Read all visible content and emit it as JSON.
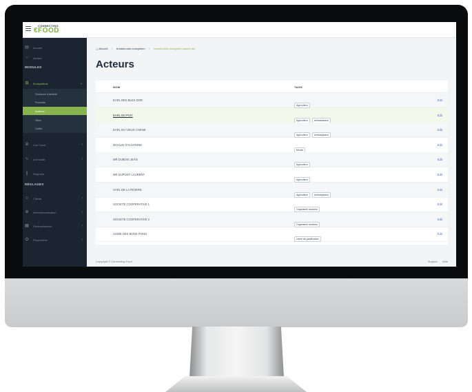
{
  "logo": {
    "top": "CONNECTING",
    "main": "€FOOD"
  },
  "sidebar": {
    "items": [
      {
        "icon": "▤",
        "label": "Accueil"
      },
      {
        "icon": "○",
        "label": "Alertes"
      }
    ],
    "section_modules": "MODULES",
    "ecosystem": {
      "icon": "⊟",
      "label": "Ecosystème",
      "chevron": "⌄"
    },
    "sub": [
      "Secteurs d'activité",
      "Produits",
      "Acteurs",
      "Sites",
      "Outils"
    ],
    "modules_after": [
      {
        "icon": "⦾",
        "label": "Live Track",
        "chevron": "›"
      },
      {
        "icon": "∿",
        "label": "Live Audit",
        "chevron": "›"
      },
      {
        "icon": "∥",
        "label": "Rapports",
        "chevron": ""
      }
    ],
    "section_reglages": "RÉGLAGES",
    "reglages": [
      {
        "icon": "☺",
        "label": "Clients",
        "chevron": "›"
      },
      {
        "icon": "⊕",
        "label": "Internationalisation",
        "chevron": "›"
      },
      {
        "icon": "▦",
        "label": "Géolocalisation",
        "chevron": "›"
      },
      {
        "icon": "⛭",
        "label": "Paramètres",
        "chevron": "›"
      }
    ]
  },
  "breadcrumb": {
    "home_icon": "⌂",
    "items": [
      "Accueil",
      "breadcrumb.ecosystem",
      "breadcrumb.ecosystem.actors.list"
    ],
    "sep": ">"
  },
  "page_title": "Acteurs",
  "table": {
    "headers": {
      "name": "NOM",
      "tags": "TAGS"
    },
    "rows": [
      {
        "name": "EARL DES BLES DOR",
        "tags": [
          "Agriculteur"
        ],
        "edit": "Edit"
      },
      {
        "name": "EARL DU PUIT",
        "tags": [
          "Agriculteur",
          "Ambassadeur"
        ],
        "edit": "Edit"
      },
      {
        "name": "EARL DU VIEUX CHENE",
        "tags": [
          "Agriculteur",
          "Ambassadeur"
        ],
        "edit": "Edit"
      },
      {
        "name": "MOULIN D'AUXONNE",
        "tags": [
          "Moulin"
        ],
        "edit": "Edit"
      },
      {
        "name": "MR DUBOIS JEAN",
        "tags": [
          "Agriculteur"
        ],
        "edit": "Edit"
      },
      {
        "name": "MR DUPONT LAURENT",
        "tags": [
          "Agriculteur"
        ],
        "edit": "Edit"
      },
      {
        "name": "SARL DE LA RIVIERE",
        "tags": [
          "Agriculteur",
          "Ambassadeur"
        ],
        "edit": "Edit"
      },
      {
        "name": "SOCIETE COOPERATIVE 1",
        "tags": [
          "Organisme stockeur"
        ],
        "edit": "Edit"
      },
      {
        "name": "SOCIETE COOPERATIVE 2",
        "tags": [
          "Organisme stockeur"
        ],
        "edit": "Edit"
      },
      {
        "name": "USINE DES BONS PAINS",
        "tags": [
          "Usine de panification"
        ],
        "edit": "Edit"
      }
    ]
  },
  "footer": {
    "copyright": "Copyright © Connecting Food",
    "links": [
      "Support",
      "Aide"
    ]
  },
  "colors": {
    "accent": "#87b44c",
    "sidebar_bg": "#1b2531",
    "link": "#4a6fd8"
  }
}
